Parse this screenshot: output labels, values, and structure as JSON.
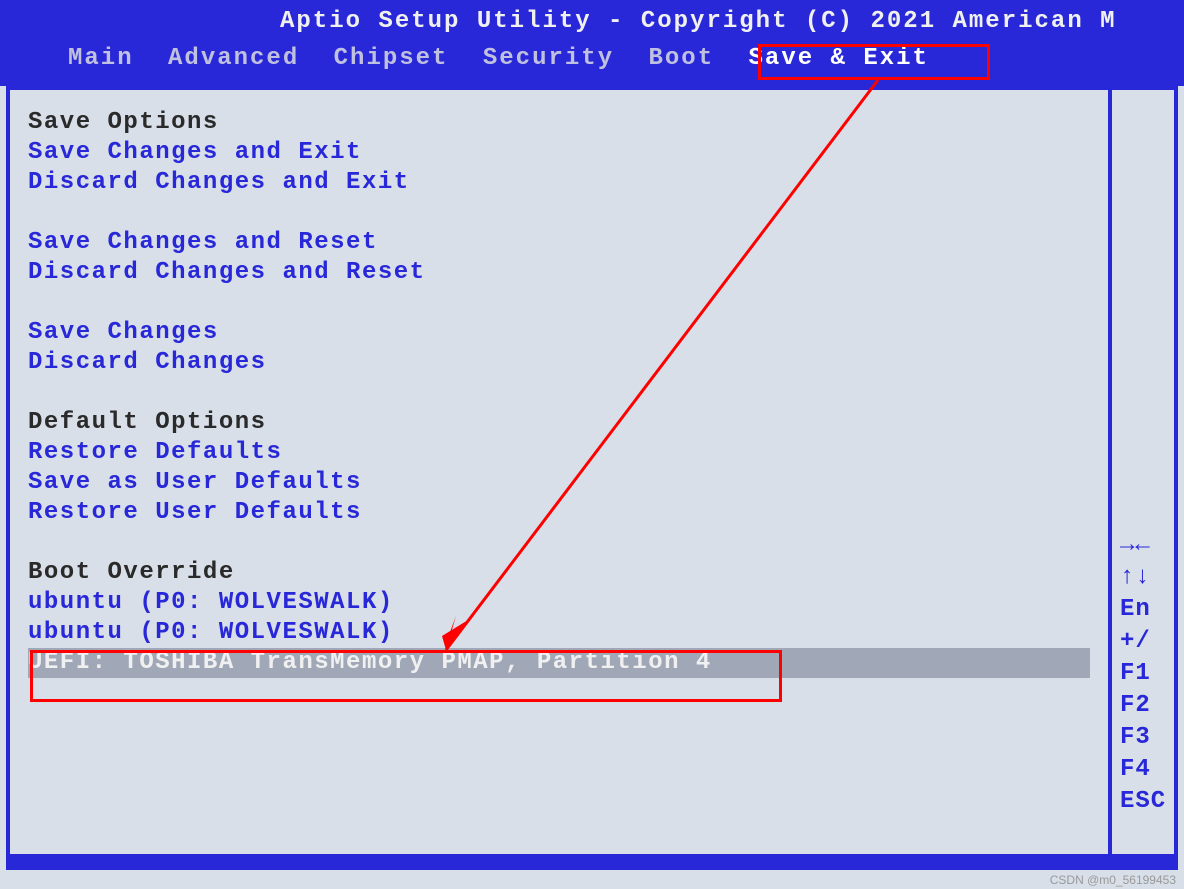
{
  "title": "Aptio Setup Utility - Copyright (C) 2021 American M",
  "nav": {
    "items": [
      {
        "label": "Main",
        "active": false
      },
      {
        "label": "Advanced",
        "active": false
      },
      {
        "label": "Chipset",
        "active": false
      },
      {
        "label": "Security",
        "active": false
      },
      {
        "label": "Boot",
        "active": false
      },
      {
        "label": "Save & Exit",
        "active": true
      }
    ]
  },
  "sections": {
    "save_options": {
      "header": "Save Options",
      "items": [
        "Save Changes and Exit",
        "Discard Changes and Exit"
      ]
    },
    "reset_options": {
      "items": [
        "Save Changes and Reset",
        "Discard Changes and Reset"
      ]
    },
    "change_options": {
      "items": [
        "Save Changes",
        "Discard Changes"
      ]
    },
    "default_options": {
      "header": "Default Options",
      "items": [
        "Restore Defaults",
        "Save as User Defaults",
        "Restore User Defaults"
      ]
    },
    "boot_override": {
      "header": "Boot Override",
      "items": [
        "ubuntu (P0: WOLVESWALK)",
        "ubuntu (P0: WOLVESWALK)",
        "UEFI: TOSHIBA TransMemory PMAP, Partition 4"
      ]
    }
  },
  "side_hints": [
    "→←",
    "↑↓",
    "En",
    "+/",
    "F1",
    "F2",
    "F3",
    "F4",
    "ESC"
  ],
  "watermark": "CSDN @m0_56199453"
}
